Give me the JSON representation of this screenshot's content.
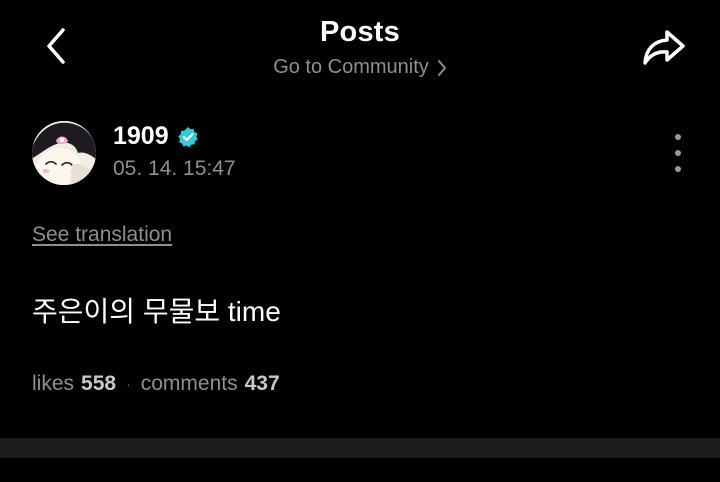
{
  "header": {
    "title": "Posts",
    "community_link": "Go to Community"
  },
  "icons": {
    "back": "chevron-left-icon",
    "share": "share-arrow-icon",
    "community_chevron": "chevron-right-icon",
    "verified": "verified-badge-icon",
    "more": "more-vertical-icon"
  },
  "post": {
    "author": "1909",
    "timestamp": "05. 14. 15:47",
    "translate_label": "See translation",
    "body": "주은이의 무물보 time",
    "likes_label": "likes",
    "likes_count": "558",
    "separator": "·",
    "comments_label": "comments",
    "comments_count": "437"
  },
  "colors": {
    "background": "#000000",
    "primary_text": "#ffffff",
    "secondary_text": "#8e8e93",
    "verified_badge": "#33c9d8",
    "divider": "#1c1c1e"
  }
}
